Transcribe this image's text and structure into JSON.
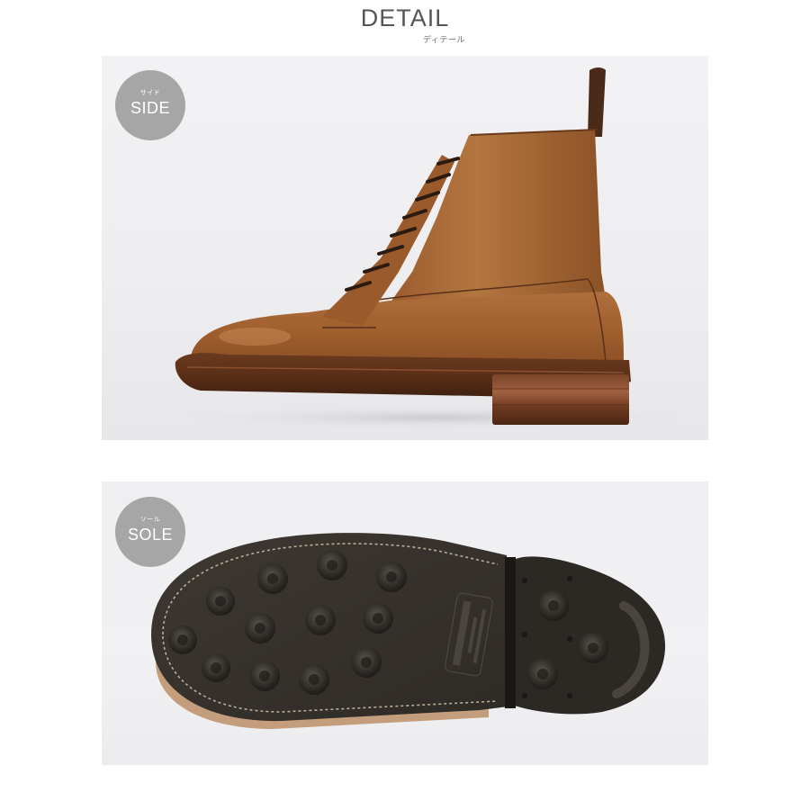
{
  "header": {
    "title": "DETAIL",
    "subtitle": "ディテール"
  },
  "sections": [
    {
      "badge_small": "サイド",
      "badge_label": "SIDE",
      "image": "boot-side-photo"
    },
    {
      "badge_small": "ソール",
      "badge_label": "SOLE",
      "image": "boot-sole-photo"
    }
  ],
  "colors": {
    "badge": "#a6a6a6",
    "leather": "#a8683a",
    "sole_rubber": "#3a3530",
    "title": "#555555"
  }
}
